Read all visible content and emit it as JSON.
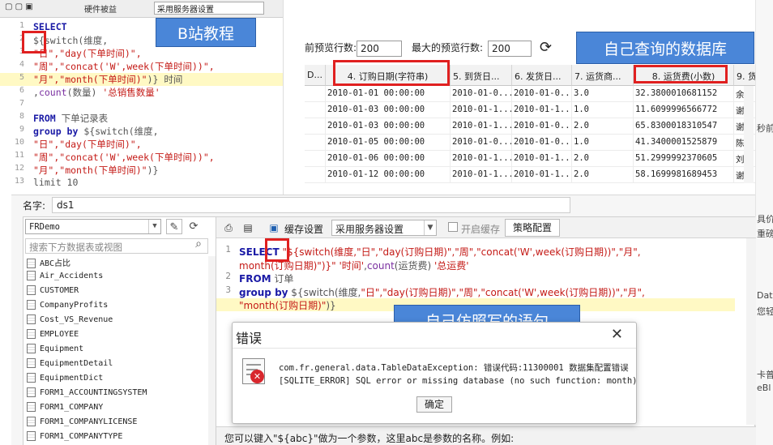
{
  "overlays": {
    "bilibili_label": "B站教程",
    "query_label": "自己查询的数据库",
    "imitate_label": "自己仿照写的语句"
  },
  "snippet": {
    "toolbar_a": "硬件被益",
    "toolbar_b": "采用服务器设置",
    "lines": [
      {
        "n": "1",
        "seg": [
          [
            "kw",
            "SELECT"
          ]
        ]
      },
      {
        "n": "2",
        "seg": [
          [
            "cn",
            "${switch(维度,"
          ]
        ]
      },
      {
        "n": "3",
        "seg": [
          [
            "str",
            "\"日\",\"day(下单时间)\","
          ]
        ]
      },
      {
        "n": "4",
        "seg": [
          [
            "str",
            "\"周\",\"concat('W',week(下单时间))\","
          ]
        ]
      },
      {
        "n": "5",
        "seg": [
          [
            "str",
            "\"月\",\"month(下单时间)\""
          ],
          [
            "cn",
            ")} 时间"
          ]
        ],
        "hl": true
      },
      {
        "n": "6",
        "seg": [
          [
            "cn",
            ","
          ],
          [
            "fn",
            "count"
          ],
          [
            "cn",
            "(数量) "
          ],
          [
            "str",
            "'总销售数量'"
          ]
        ]
      },
      {
        "n": "7",
        "seg": []
      },
      {
        "n": "8",
        "seg": [
          [
            "kw",
            "FROM"
          ],
          [
            "cn",
            " 下单记录表"
          ]
        ]
      },
      {
        "n": "9",
        "seg": [
          [
            "kw",
            "group by"
          ],
          [
            "cn",
            " ${switch(维度,"
          ]
        ]
      },
      {
        "n": "10",
        "seg": [
          [
            "str",
            "\"日\",\"day(下单时间)\","
          ]
        ]
      },
      {
        "n": "11",
        "seg": [
          [
            "str",
            "\"周\",\"concat('W',week(下单时间))\","
          ]
        ]
      },
      {
        "n": "12",
        "seg": [
          [
            "str",
            "\"月\",\"month(下单时间)\""
          ],
          [
            "cn",
            ")}"
          ]
        ]
      },
      {
        "n": "13",
        "seg": [
          [
            "cn",
            "limit 10"
          ]
        ]
      }
    ]
  },
  "grid": {
    "preview_label": "前预览行数:",
    "preview_value": "200",
    "max_label": "最大的预览行数:",
    "max_value": "200",
    "refresh_icon": "refresh-icon",
    "columns": [
      "D...",
      "4. 订购日期(字符串)",
      "5. 到货日...",
      "6. 发货日...",
      "7. 运货商...",
      "8. 运货费(小数)",
      "9. 货"
    ],
    "rows": [
      [
        "",
        "2010-01-01 00:00:00",
        "2010-01-0...",
        "2010-01-0...",
        "3.0",
        "32.3800010681152",
        "余小"
      ],
      [
        "",
        "2010-01-03 00:00:00",
        "2010-01-1...",
        "2010-01-1...",
        "1.0",
        "11.6099996566772",
        "谢小"
      ],
      [
        "",
        "2010-01-03 00:00:00",
        "2010-01-1...",
        "2010-01-0...",
        "2.0",
        "65.8300018310547",
        "谢小"
      ],
      [
        "",
        "2010-01-05 00:00:00",
        "2010-01-0...",
        "2010-01-0...",
        "1.0",
        "41.3400001525879",
        "陈先"
      ],
      [
        "",
        "2010-01-06 00:00:00",
        "2010-01-1...",
        "2010-01-1...",
        "2.0",
        "51.2999992370605",
        "刘先"
      ],
      [
        "",
        "2010-01-12 00:00:00",
        "2010-01-1...",
        "2010-01-1...",
        "2.0",
        "58.1699981689453",
        "谢小"
      ]
    ]
  },
  "strip": [
    "具价",
    "重磅",
    "秒前",
    "Data",
    "您轻",
    "卡普",
    "eBl"
  ],
  "designer": {
    "name_label": "名字:",
    "name_value": "ds1",
    "db_select": "FRDemo",
    "search_placeholder": "搜索下方数据表或视图",
    "tables": [
      "ABC占比",
      "Air_Accidents",
      "CUSTOMER",
      "CompanyProfits",
      "Cost_VS_Revenue",
      "EMPLOYEE",
      "Equipment",
      "EquipmentDetail",
      "EquipmentDict",
      "FORM1_ACCOUNTINGSYSTEM",
      "FORM1_COMPANY",
      "FORM1_COMPANYLICENSE",
      "FORM1_COMPANYTYPE"
    ],
    "cache_label": "缓存设置",
    "server_select": "采用服务器设置",
    "enable_cache_label": "开启缓存",
    "strategy_tab": "策略配置",
    "editor_lines": [
      {
        "n": "1",
        "seg": [
          [
            "kw",
            "SELECT"
          ],
          [
            "cn",
            " "
          ],
          [
            "str",
            "\"${switch(维度,\"日\",\"day(订购日期)\",\"周\",\"concat('W',week(订购日期))\",\"月\","
          ]
        ]
      },
      {
        "n": "",
        "seg": [
          [
            "str",
            "month(订购日期)\")}\""
          ],
          [
            "cn",
            " "
          ],
          [
            "str",
            "'时间'"
          ],
          [
            "cn",
            ","
          ],
          [
            "fn",
            "count"
          ],
          [
            "cn",
            "(运货费) "
          ],
          [
            "str",
            "'总运费'"
          ]
        ]
      },
      {
        "n": "2",
        "seg": [
          [
            "kw",
            "FROM"
          ],
          [
            "cn",
            " 订单"
          ]
        ]
      },
      {
        "n": "3",
        "seg": [
          [
            "kw",
            "group by"
          ],
          [
            "cn",
            " ${switch(维度,"
          ],
          [
            "str",
            "\"日\",\"day(订购日期)\",\"周\",\"concat('W',week(订购日期))\",\"月\","
          ]
        ]
      },
      {
        "n": "",
        "seg": [
          [
            "str",
            "\"month(订购日期)\""
          ],
          [
            "cn",
            ")}"
          ]
        ],
        "hl": true
      }
    ],
    "help_text": "您可以键入\"${abc}\"做为一个参数，这里abc是参数的名称。例如:"
  },
  "dialog": {
    "title": "错误",
    "line1": "com.fr.general.data.TableDataException: 错误代码:11300001 数据集配置错误",
    "line2": "[SQLITE_ERROR] SQL error or missing database (no such function: month)",
    "ok_label": "确定"
  }
}
